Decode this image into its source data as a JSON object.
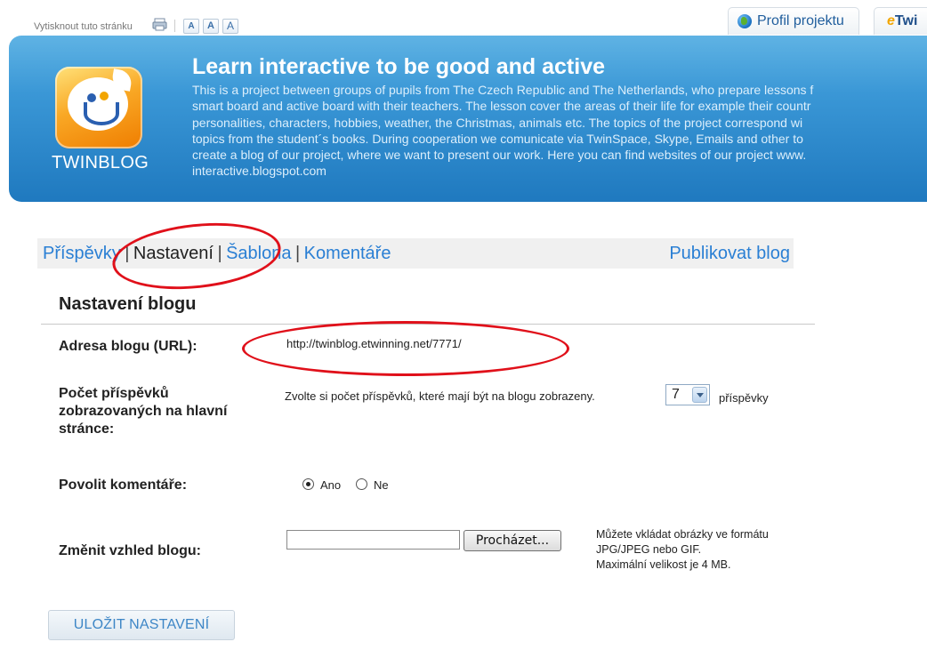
{
  "topbar": {
    "print_label": "Vytisknout tuto stránku",
    "font_sizes": [
      "A",
      "A",
      "A"
    ],
    "tabs": [
      {
        "label": "Profil projektu",
        "icon": "globe-icon"
      },
      {
        "label_prefix": "e",
        "label": "Twi"
      }
    ]
  },
  "banner": {
    "logo_text": "TWINBLOG",
    "title": "Learn interactive to be good and active",
    "description": "This is a project between groups of pupils from The Czech Republic and The Netherlands, who prepare lessons f\nsmart board and active board with their teachers. The lesson cover the areas of their life for example their countr\npersonalities, characters, hobbies, weather, the Christmas, animals etc. The topics of the project correspond wi\ntopics from the student´s books. During cooperation we comunicate via TwinSpace, Skype, Emails and other to\ncreate a blog of our project, where we want to present our work. Here you can find websites of our project www.\ninteractive.blogspot.com"
  },
  "nav": {
    "items": [
      "Příspěvky",
      "Nastavení",
      "Šablona",
      "Komentáře"
    ],
    "separator": "|",
    "publish": "Publikovat blog"
  },
  "settings": {
    "section_title": "Nastavení blogu",
    "url_label": "Adresa blogu (URL):",
    "url_value": "http://twinblog.etwinning.net/7771/",
    "count_label": "Počet příspěvků zobrazovaných na hlavní stránce:",
    "count_hint": "Zvolte si počet příspěvků, které mají být na blogu zobrazeny.",
    "count_value": "7",
    "count_suffix": "příspěvky",
    "comments_label": "Povolit komentáře:",
    "comments_yes": "Ano",
    "comments_no": "Ne",
    "comments_selected": "Ano",
    "appearance_label": "Změnit vzhled blogu:",
    "browse_label": "Procházet...",
    "file_hint": "Můžete vkládat obrázky ve formátu\nJPG/JPEG nebo GIF.\nMaximální velikost je 4 MB.",
    "save_label": "ULOŽIT NASTAVENÍ"
  },
  "colors": {
    "banner": "#2f8fd2",
    "link": "#2a7fd4",
    "annotation": "#e0101a"
  }
}
